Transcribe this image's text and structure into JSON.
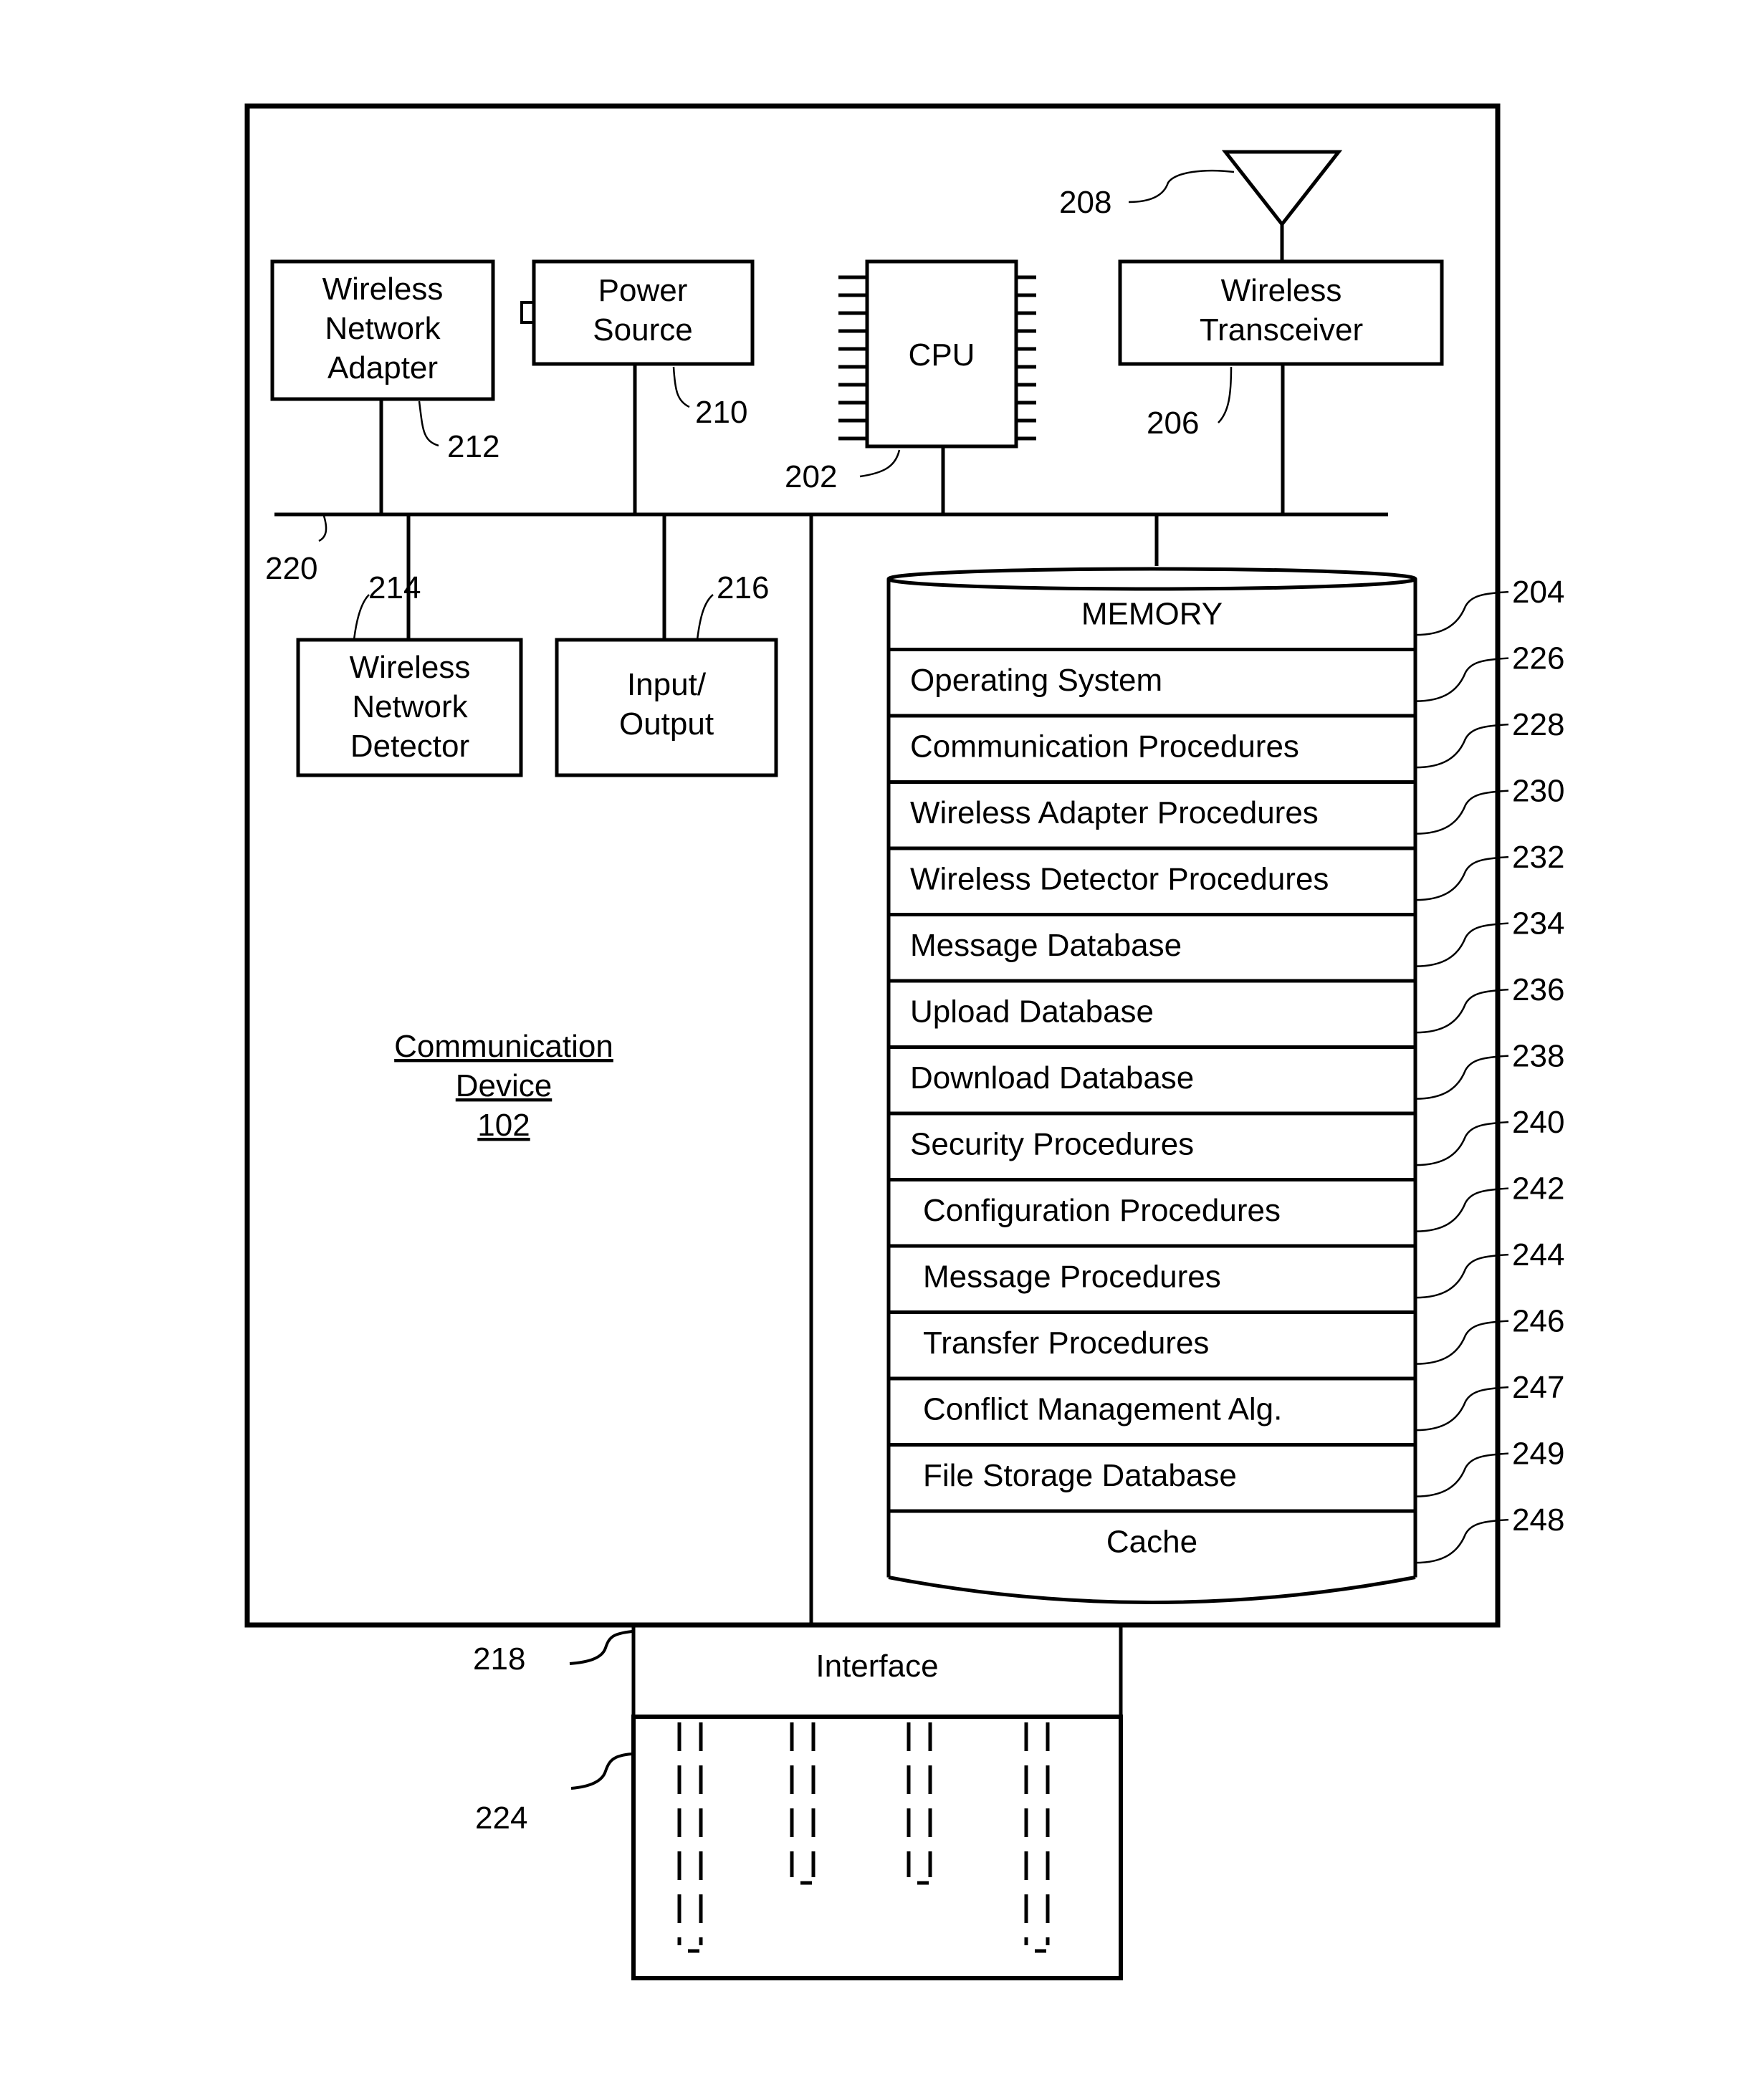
{
  "device": {
    "title_line1": "Communication",
    "title_line2": "Device",
    "ref": "102"
  },
  "components": {
    "wireless_network_adapter": {
      "lines": [
        "Wireless",
        "Network",
        "Adapter"
      ],
      "ref": "212"
    },
    "power_source": {
      "lines": [
        "Power",
        "Source"
      ],
      "ref": "210"
    },
    "cpu": {
      "lines": [
        "CPU"
      ],
      "ref": "202"
    },
    "wireless_transceiver": {
      "lines": [
        "Wireless",
        "Transceiver"
      ],
      "ref": "206"
    },
    "antenna": {
      "ref": "208"
    },
    "bus": {
      "ref": "220"
    },
    "wireless_network_detector": {
      "lines": [
        "Wireless",
        "Network",
        "Detector"
      ],
      "ref": "214"
    },
    "input_output": {
      "lines": [
        "Input/",
        "Output"
      ],
      "ref": "216"
    },
    "interface": {
      "label": "Interface",
      "ref": "218"
    },
    "connector": {
      "ref": "224"
    }
  },
  "memory": {
    "title": "MEMORY",
    "ref": "204",
    "items": [
      {
        "label": "Operating System",
        "ref": "226"
      },
      {
        "label": "Communication Procedures",
        "ref": "228"
      },
      {
        "label": "Wireless Adapter Procedures",
        "ref": "230"
      },
      {
        "label": "Wireless Detector Procedures",
        "ref": "232"
      },
      {
        "label": "Message Database",
        "ref": "234"
      },
      {
        "label": "Upload Database",
        "ref": "236"
      },
      {
        "label": "Download Database",
        "ref": "238"
      },
      {
        "label": "Security Procedures",
        "ref": "240"
      },
      {
        "label": "Configuration Procedures",
        "ref": "242"
      },
      {
        "label": "Message Procedures",
        "ref": "244"
      },
      {
        "label": "Transfer Procedures",
        "ref": "246"
      },
      {
        "label": "Conflict Management Alg.",
        "ref": "247"
      },
      {
        "label": "File Storage Database",
        "ref": "249"
      }
    ],
    "cache": {
      "label": "Cache",
      "ref": "248"
    }
  }
}
